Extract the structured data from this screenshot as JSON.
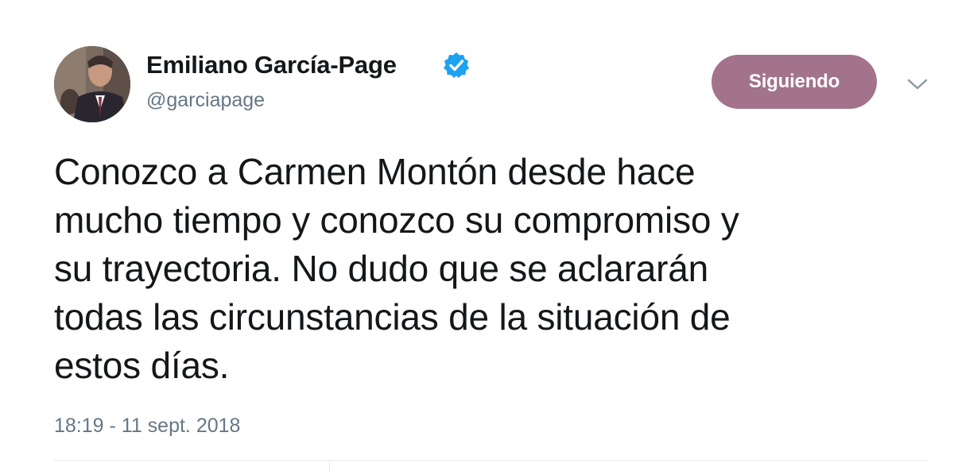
{
  "author": {
    "name": "Emiliano García-Page",
    "handle": "@garciapage",
    "verified": true
  },
  "follow_button": {
    "label": "Siguiendo",
    "color": "#a3728b"
  },
  "menu": {
    "icon": "chevron-down-icon"
  },
  "tweet": {
    "lines": [
      "Conozco a Carmen Montón desde hace",
      "mucho tiempo y conozco su compromiso y",
      "su trayectoria. No dudo que se aclararán",
      "todas las circunstancias de la situación de",
      "estos días."
    ],
    "timestamp": "18:19 - 11 sept. 2018"
  },
  "colors": {
    "text": "#14171a",
    "secondary": "#657786",
    "verified": "#1da1f2"
  }
}
